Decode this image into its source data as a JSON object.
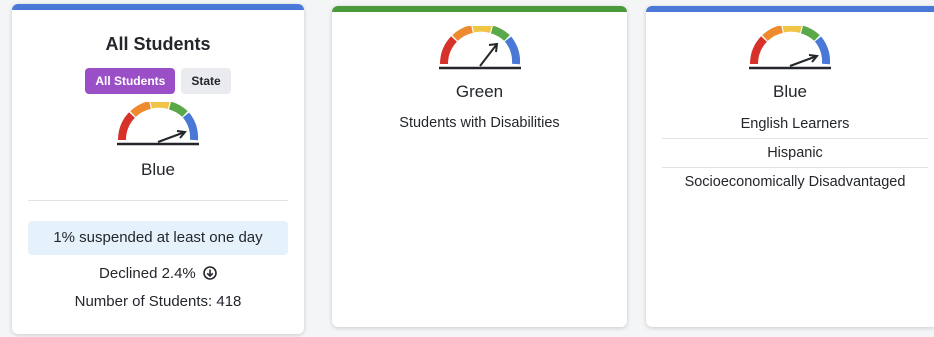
{
  "colors": {
    "blue_bar": "#4a78d6",
    "green_bar": "#4a9a3c",
    "pill_active": "#9b4fc7",
    "info_bg": "#e6f2fb",
    "gauge_red": "#d7322a",
    "gauge_orange": "#ef8a2f",
    "gauge_yellow": "#f0c445",
    "gauge_green": "#5aa84a",
    "gauge_blue": "#4a78d6"
  },
  "all_students": {
    "title": "All Students",
    "toggle": {
      "active": "All Students",
      "inactive": "State"
    },
    "gauge_icon": "gauge-icon",
    "level": "Blue",
    "suspended_text": "1% suspended at least one day",
    "change_text": "Declined 2.4%",
    "change_icon": "arrow-down-circle-icon",
    "count_text": "Number of Students: 418"
  },
  "green_card": {
    "level": "Green",
    "groups": [
      "Students with Disabilities"
    ]
  },
  "blue_card": {
    "level": "Blue",
    "groups": [
      "English Learners",
      "Hispanic",
      "Socioeconomically Disadvantaged"
    ]
  }
}
